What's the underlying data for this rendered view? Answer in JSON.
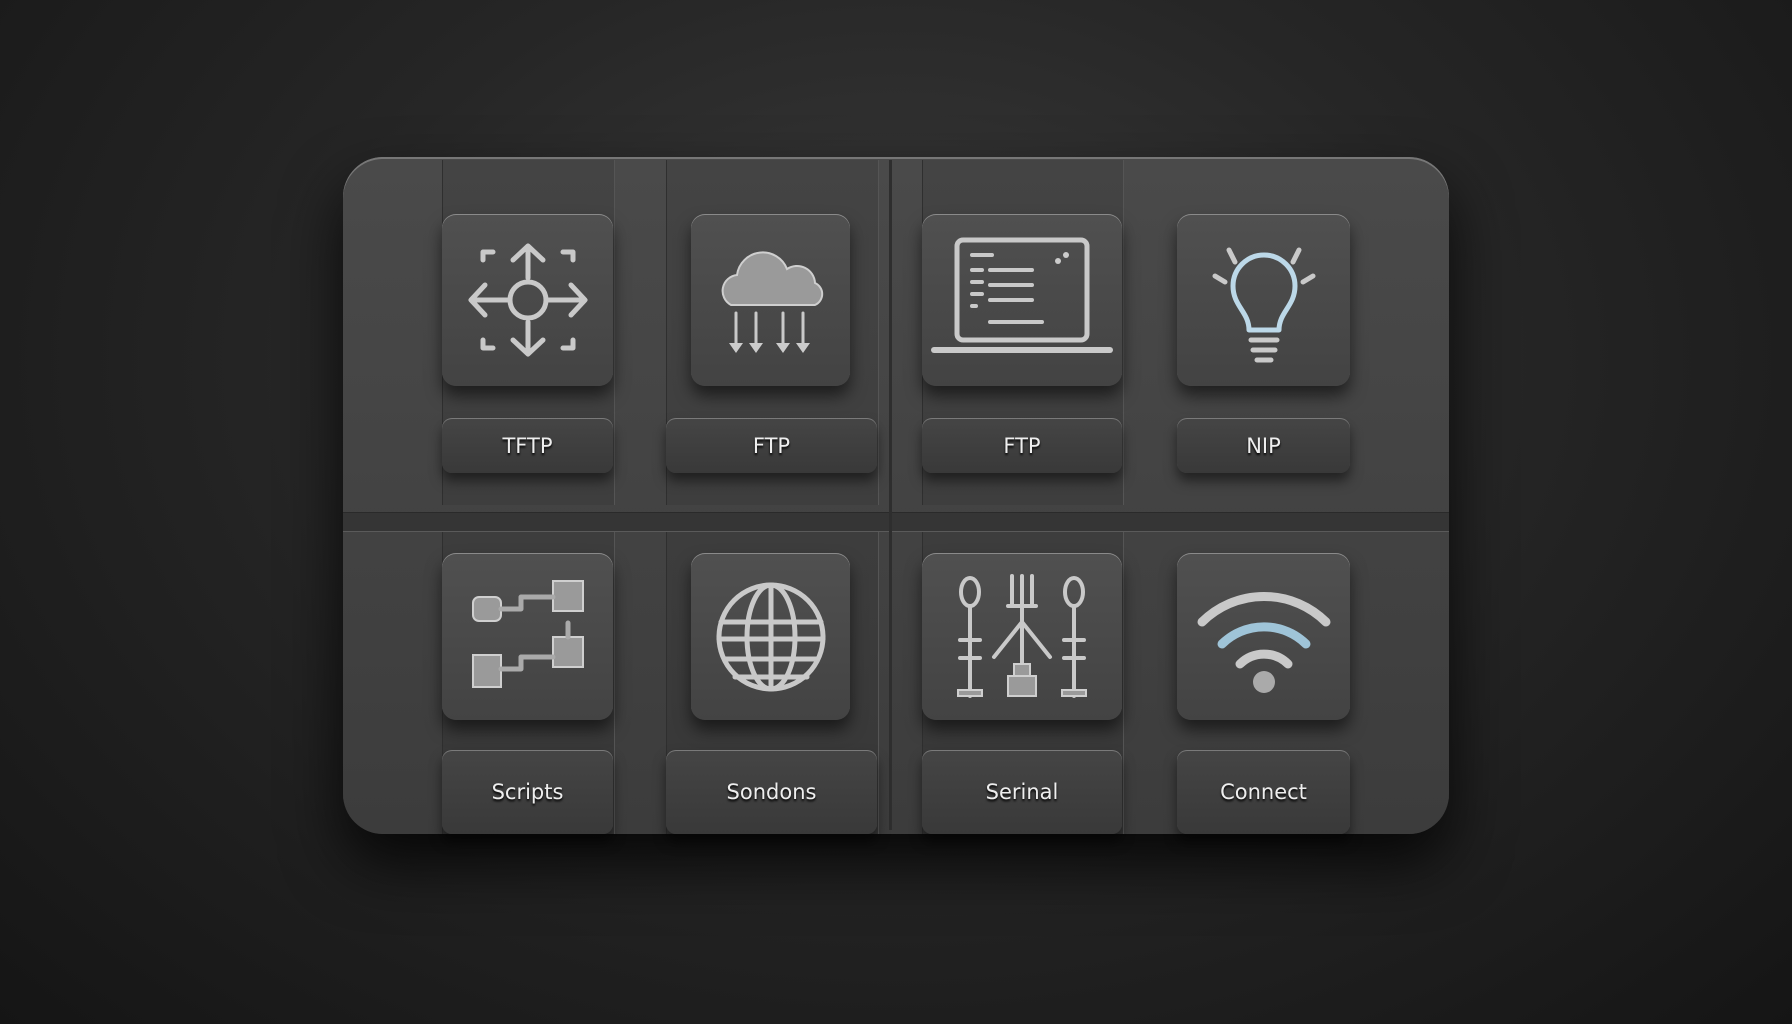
{
  "tiles": [
    {
      "label": "TFTP",
      "icon": "move-arrows-icon"
    },
    {
      "label": "FTP",
      "icon": "cloud-download-icon"
    },
    {
      "label": "FTP",
      "icon": "laptop-icon"
    },
    {
      "label": "NIP",
      "icon": "lightbulb-icon"
    },
    {
      "label": "Scripts",
      "icon": "flowchart-icon"
    },
    {
      "label": "Sondons",
      "icon": "globe-icon"
    },
    {
      "label": "Serinal",
      "icon": "serial-connectors-icon"
    },
    {
      "label": "Connect",
      "icon": "wifi-icon"
    }
  ],
  "colors": {
    "panel": "#444444",
    "background": "#1e1e1e",
    "accent": "#8fc9e8"
  }
}
